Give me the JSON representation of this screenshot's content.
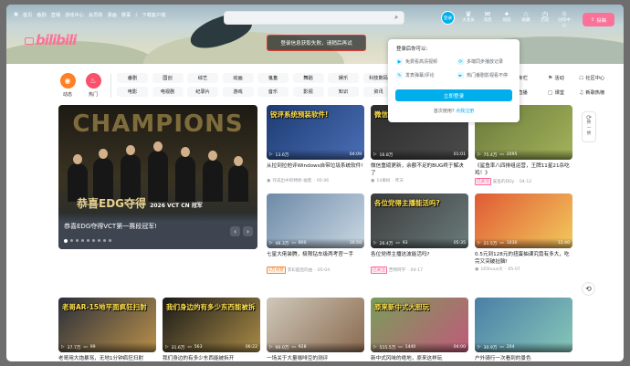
{
  "nav": {
    "items": [
      "首页",
      "番剧",
      "直播",
      "游戏中心",
      "会员购",
      "漫画",
      "赛事",
      "下载客户端"
    ],
    "avatar_label": "登录",
    "right_icons": [
      {
        "icon": "crown-icon",
        "label": "大会员"
      },
      {
        "icon": "message-icon",
        "label": "消息"
      },
      {
        "icon": "star-icon",
        "label": "动态"
      },
      {
        "icon": "bookmark-icon",
        "label": "收藏"
      },
      {
        "icon": "clock-icon",
        "label": "历史"
      },
      {
        "icon": "bulb-icon",
        "label": "创作中心"
      }
    ],
    "upload_label": "投稿"
  },
  "brand": {
    "logo_text": "bilibili"
  },
  "notice": {
    "text": "登录信息获取失败，请稍后再试"
  },
  "channels": {
    "primary": [
      {
        "label": "动态",
        "icon": "dynamic-icon",
        "color": "#ff7f24"
      },
      {
        "label": "热门",
        "icon": "fire-icon",
        "color": "#f9506b"
      }
    ],
    "tags_row1": [
      "番剧",
      "国创",
      "综艺",
      "动画",
      "鬼畜",
      "舞蹈",
      "娱乐",
      "科技数码"
    ],
    "tags_row2": [
      "电影",
      "电视剧",
      "纪录片",
      "游戏",
      "音乐",
      "影视",
      "知识",
      "资讯"
    ],
    "extra": [
      {
        "icon": "store-icon",
        "label": "专栏"
      },
      {
        "icon": "activity-icon",
        "label": "活动"
      },
      {
        "icon": "community-icon",
        "label": "社区中心"
      },
      {
        "icon": "live-icon",
        "label": "直播"
      },
      {
        "icon": "class-icon",
        "label": "课堂"
      },
      {
        "icon": "music-icon",
        "label": "新歌热榜"
      }
    ]
  },
  "carousel": {
    "big_text": "CHAMPIONS",
    "sub_text": "恭喜EDG夺得",
    "badge_text": "2026 VCT CN 冠军",
    "caption": "恭喜EDG夺得VCT第一赛段冠军!",
    "dots": 9,
    "active_dot": 1
  },
  "login_popup": {
    "title": "登录后你可以:",
    "features": [
      {
        "icon": "hd-icon",
        "label": "免费看高清视频"
      },
      {
        "icon": "sync-icon",
        "label": "多端同步播放记录"
      },
      {
        "icon": "comment-icon",
        "label": "发表弹幕/评论"
      },
      {
        "icon": "play-icon",
        "label": "热门番剧影视看不停"
      }
    ],
    "login_button": "立即登录",
    "register_prefix": "首次使用?",
    "register_link": "点我注册"
  },
  "side": {
    "refresh_label": "换一换"
  },
  "cards": [
    {
      "overlay": "锐评系统预装软件!",
      "views": "13.6万",
      "danmaku": "",
      "duration": "04:09",
      "title": "从拉到拉他评Windows自带垃圾系统软件!",
      "badge": "",
      "author": "作说出中的特修-福客",
      "date": "05-06",
      "colors": [
        "#1d3b73",
        "#4a6fb5"
      ]
    },
    {
      "overlay": "微信重磅更新",
      "views": "16.8万",
      "danmaku": "",
      "duration": "01:01",
      "title": "微信重磅更新，余额不足的BUG终于解决了",
      "badge": "",
      "author": "14果树",
      "date": "昨天",
      "colors": [
        "#2d2d2d",
        "#4b4b4b"
      ]
    },
    {
      "overlay": "",
      "views": "75.4万",
      "danmaku": "2095",
      "duration": "",
      "title": "《鲨鱼率八四排组运营，王牌11星21杀吃鸡！》",
      "badge": "已关注",
      "author": "鲨鱼的DDy",
      "date": "04-12",
      "colors": [
        "#6a7a3c",
        "#a3b35a"
      ]
    },
    {
      "overlay": "",
      "views": "46.3万",
      "danmaku": "800",
      "duration": "16:50",
      "title": "七星大佬装腾，极限钻车级两考官一手",
      "badge": "1万点赞",
      "author": "李彩超后的由",
      "date": "05-04",
      "colors": [
        "#6d8aa8",
        "#c9d7e2"
      ]
    },
    {
      "overlay": "各位党得主播能活吗?",
      "views": "26.4万",
      "danmaku": "93",
      "duration": "05:35",
      "title": "各位党得主播这波能活吗?",
      "badge": "已关注",
      "author": "苦特阿学",
      "date": "04-17",
      "colors": [
        "#3b3b3b",
        "#6b7b7b"
      ]
    },
    {
      "overlay": "",
      "views": "21.5万",
      "danmaku": "1030",
      "duration": "12:40",
      "title": "0.5元到128元的扭蛋抽课究竟有多大，吃完又突破扯脑!",
      "badge": "",
      "author": "165huus大",
      "date": "05-07",
      "colors": [
        "#e05a35",
        "#f2c95c"
      ]
    },
    {
      "overlay": "老哥AR-15地平面疯狂扫射",
      "views": "37.7万",
      "danmaku": "99",
      "duration": "",
      "title": "老哥用大炮暴骂，无地1分钟疯狂扫射",
      "badge": "",
      "author": "",
      "date": "",
      "colors": [
        "#2a2f3a",
        "#b88f4a"
      ]
    },
    {
      "overlay": "我们身边的有多少东西能被拆",
      "views": "31.6万",
      "danmaku": "563",
      "duration": "06:22",
      "title": "我们身边的有多少东西能被拆开",
      "badge": "",
      "author": "",
      "date": "",
      "colors": [
        "#1a1a1a",
        "#a88a45"
      ]
    },
    {
      "overlay": "",
      "views": "90.0万",
      "danmaku": "928",
      "duration": "",
      "title": "一场关于大量咖啡豆的测评",
      "badge": "",
      "author": "",
      "date": "",
      "colors": [
        "#cfc8bb",
        "#8a6a4e"
      ]
    },
    {
      "overlay": "原来新中式大胆玩",
      "views": "515.5万",
      "danmaku": "1440",
      "duration": "04:00",
      "title": "新中式风味的绝地，原来这样玩",
      "badge": "",
      "author": "",
      "date": "",
      "colors": [
        "#7a9d5a",
        "#c05a7a"
      ]
    },
    {
      "overlay": "",
      "views": "30.9万",
      "danmaku": "204",
      "duration": "",
      "title": "户外骑行一次看到的景色",
      "badge": "",
      "author": "",
      "date": "",
      "colors": [
        "#4a7fa6",
        "#86c6b8"
      ]
    }
  ]
}
